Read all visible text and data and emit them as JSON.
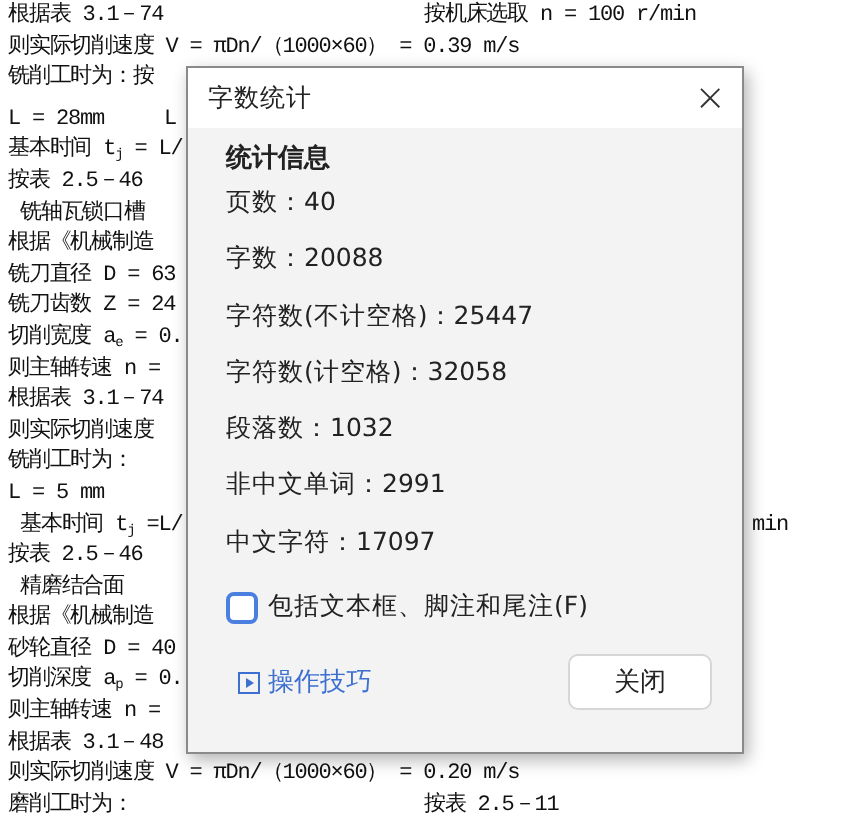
{
  "document": {
    "lines": [
      {
        "text": "根据表 3.1－74",
        "middle_text": "按机床选取 n = 100 r/min"
      },
      {
        "text": "则实际切削速度 V = πDn/（1000×60） = 0.39 m/s"
      },
      {
        "text": "铣削工时为：按"
      },
      {
        "text": "L = 28mm     L"
      },
      {
        "text": "基本时间 t$_{j}$ = L/"
      },
      {
        "text": "按表 2.5－46"
      },
      {
        "text": " 铣轴瓦锁口槽"
      },
      {
        "text": "根据《机械制造"
      },
      {
        "text": "铣刀直径 D = 63"
      },
      {
        "text": "铣刀齿数 Z = 24"
      },
      {
        "text": "切削宽度 a$_{e}$ = 0."
      },
      {
        "text": "则主轴转速 n ="
      },
      {
        "text": "根据表 3.1－74"
      },
      {
        "text": "则实际切削速度"
      },
      {
        "text": "铣削工时为："
      },
      {
        "text": "L = 5 mm"
      },
      {
        "text": " 基本时间 t$_{j}$ =L/",
        "end_text": "min"
      },
      {
        "text": "按表 2.5－46"
      },
      {
        "text": " 精磨结合面"
      },
      {
        "text": "根据《机械制造"
      },
      {
        "text": "砂轮直径 D = 40"
      },
      {
        "text": "切削深度 a$_{p}$ = 0."
      },
      {
        "text": "则主轴转速 n ="
      },
      {
        "text": "根据表 3.1－48"
      },
      {
        "text": "则实际切削速度 V = πDn/（1000×60） = 0.20 m/s"
      },
      {
        "text": "磨削工时为：",
        "middle_text": "按表 2.5－11"
      }
    ]
  },
  "dialog": {
    "title": "字数统计",
    "close_icon": "×",
    "heading": "统计信息",
    "stats": [
      "页数：40",
      "字数：20088",
      "字符数(不计空格)：25447",
      "字符数(计空格)：32058",
      "段落数：1032",
      "非中文单词：2991",
      "中文字符：17097"
    ],
    "checkbox": {
      "label": "包括文本框、脚注和尾注(F)",
      "checked": false
    },
    "tips_link": "操作技巧",
    "close_button": "关闭"
  }
}
